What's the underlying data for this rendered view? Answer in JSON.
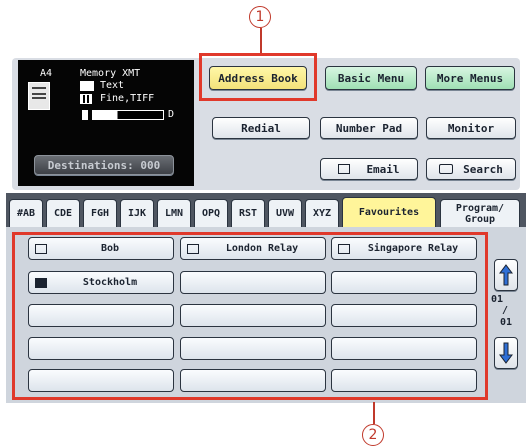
{
  "callouts": {
    "one": "1",
    "two": "2"
  },
  "status": {
    "paper": "A4",
    "memory": "Memory XMT",
    "mode": "Text",
    "resolution": "Fine,TIFF",
    "dark_mark": "D",
    "destinations_label": "Destinations: 000"
  },
  "top_buttons": {
    "address_book": "Address Book",
    "basic_menu": "Basic Menu",
    "more_menus": "More Menus",
    "redial": "Redial",
    "number_pad": "Number Pad",
    "monitor": "Monitor",
    "email": "Email",
    "search": "Search"
  },
  "tabs": [
    "#AB",
    "CDE",
    "FGH",
    "IJK",
    "LMN",
    "OPQ",
    "RST",
    "UVW",
    "XYZ",
    "Favourites",
    "Program/ Group"
  ],
  "active_tab": "Favourites",
  "destinations": [
    {
      "label": "Bob",
      "icon": "email-icon"
    },
    {
      "label": "London Relay",
      "icon": "email-icon"
    },
    {
      "label": "Singapore Relay",
      "icon": "email-icon"
    },
    {
      "label": "Stockholm",
      "icon": "fax-icon"
    },
    {
      "label": "",
      "icon": ""
    },
    {
      "label": "",
      "icon": ""
    },
    {
      "label": "",
      "icon": ""
    },
    {
      "label": "",
      "icon": ""
    },
    {
      "label": "",
      "icon": ""
    },
    {
      "label": "",
      "icon": ""
    },
    {
      "label": "",
      "icon": ""
    },
    {
      "label": "",
      "icon": ""
    },
    {
      "label": "",
      "icon": ""
    },
    {
      "label": "",
      "icon": ""
    },
    {
      "label": "",
      "icon": ""
    }
  ],
  "pager": {
    "current": "01",
    "separator": "/",
    "total": "01"
  },
  "colors": {
    "highlight": "#e0392b",
    "active_tab": "#fff59a",
    "screen": "#050505"
  }
}
